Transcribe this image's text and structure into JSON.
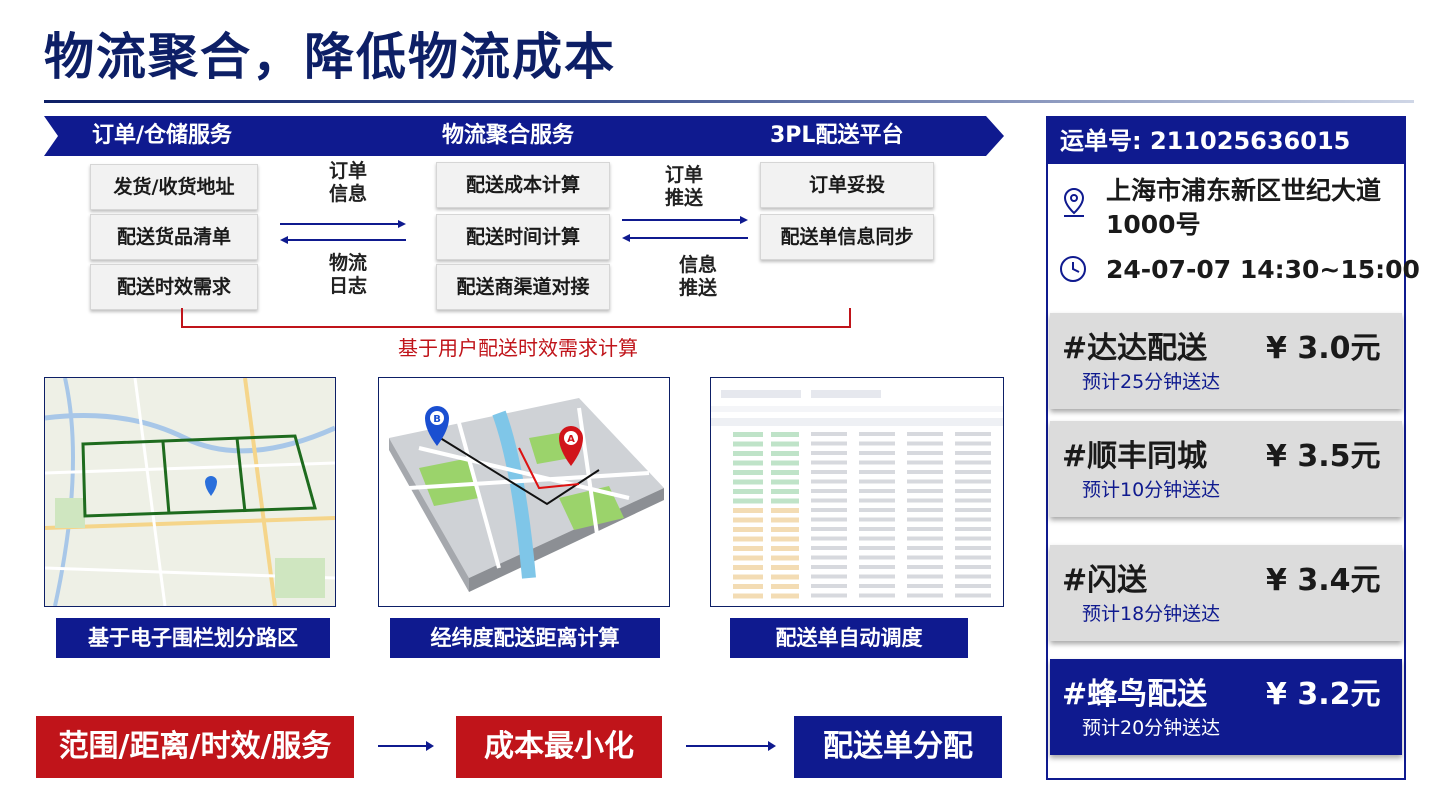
{
  "title": "物流聚合，降低物流成本",
  "band": {
    "col1": "订单/仓储服务",
    "col2": "物流聚合服务",
    "col3": "3PL配送平台"
  },
  "col1_items": [
    "发货/收货地址",
    "配送货品清单",
    "配送时效需求"
  ],
  "col2_items": [
    "配送成本计算",
    "配送时间计算",
    "配送商渠道对接"
  ],
  "col3_items": [
    "订单妥投",
    "配送单信息同步"
  ],
  "arrows": {
    "left_top": [
      "订单",
      "信息"
    ],
    "left_bottom": [
      "物流",
      "日志"
    ],
    "right_top": [
      "订单",
      "推送"
    ],
    "right_bottom": [
      "信息",
      "推送"
    ]
  },
  "bracket_text": "基于用户配送时效需求计算",
  "captions": [
    "基于电子围栏划分路区",
    "经纬度配送距离计算",
    "配送单自动调度"
  ],
  "flow": {
    "step1": "范围/距离/时效/服务",
    "step2": "成本最小化",
    "step3": "配送单分配"
  },
  "order_panel": {
    "order_no": "运单号: 211025636015",
    "address_line1": "上海市浦东新区世纪大道",
    "address_line2": "1000号",
    "time": "24-07-07 14:30~15:00",
    "options": [
      {
        "name": "#达达配送",
        "price": "¥ 3.0元",
        "eta": "预计25分钟送达",
        "selected": false
      },
      {
        "name": "#顺丰同城",
        "price": "¥ 3.5元",
        "eta": "预计10分钟送达",
        "selected": false
      },
      {
        "name": "#闪送",
        "price": "¥ 3.4元",
        "eta": "预计18分钟送达",
        "selected": false
      },
      {
        "name": "#蜂鸟配送",
        "price": "¥ 3.2元",
        "eta": "预计20分钟送达",
        "selected": true
      }
    ]
  },
  "map_pins": {
    "a": "A",
    "b": "B"
  },
  "colors": {
    "navy": "#0f1a8f",
    "title_navy": "#0d1f66",
    "red": "#c0141a",
    "card_grey": "#dcdcdc"
  }
}
